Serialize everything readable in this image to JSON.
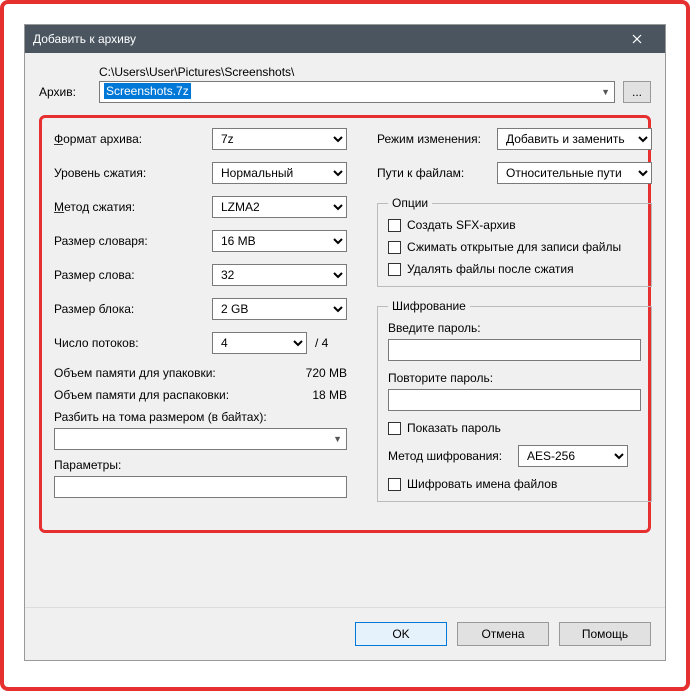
{
  "title": "Добавить к архиву",
  "archive": {
    "label": "Архив:",
    "path": "C:\\Users\\User\\Pictures\\Screenshots\\",
    "filename": "Screenshots.7z",
    "browse": "..."
  },
  "left": {
    "format": {
      "label": "Формат архива:",
      "value": "7z"
    },
    "level": {
      "label": "Уровень сжатия:",
      "value": "Нормальный"
    },
    "method": {
      "label": "Метод сжатия:",
      "value": "LZMA2"
    },
    "dict": {
      "label": "Размер словаря:",
      "value": "16 MB"
    },
    "word": {
      "label": "Размер слова:",
      "value": "32"
    },
    "block": {
      "label": "Размер блока:",
      "value": "2 GB"
    },
    "threads": {
      "label": "Число потоков:",
      "value": "4",
      "max": "/ 4"
    },
    "mem_pack": {
      "label": "Объем памяти для упаковки:",
      "value": "720 MB"
    },
    "mem_unpack": {
      "label": "Объем памяти для распаковки:",
      "value": "18 MB"
    },
    "split": {
      "label": "Разбить на тома размером (в байтах):"
    },
    "params": {
      "label": "Параметры:"
    }
  },
  "right": {
    "mode": {
      "label": "Режим изменения:",
      "value": "Добавить и заменить"
    },
    "paths": {
      "label": "Пути к файлам:",
      "value": "Относительные пути"
    },
    "options": {
      "legend": "Опции",
      "sfx": "Создать SFX-архив",
      "compress_open": "Сжимать открытые для записи файлы",
      "delete_after": "Удалять файлы после сжатия"
    },
    "encryption": {
      "legend": "Шифрование",
      "pwd1": "Введите пароль:",
      "pwd2": "Повторите пароль:",
      "show": "Показать пароль",
      "method": {
        "label": "Метод шифрования:",
        "value": "AES-256"
      },
      "encrypt_names": "Шифровать имена файлов"
    }
  },
  "buttons": {
    "ok": "OK",
    "cancel": "Отмена",
    "help": "Помощь"
  }
}
